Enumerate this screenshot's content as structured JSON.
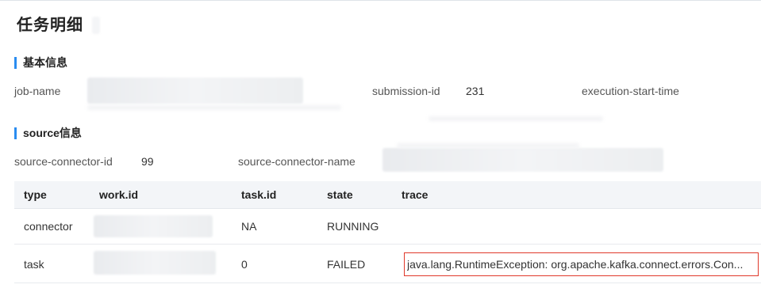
{
  "page": {
    "title": "任务明细"
  },
  "basic_info": {
    "section_title": "基本信息",
    "job_name_label": "job-name",
    "submission_id_label": "submission-id",
    "submission_id_value": "231",
    "execution_start_time_label": "execution-start-time"
  },
  "source_info": {
    "section_title": "source信息",
    "connector_id_label": "source-connector-id",
    "connector_id_value": "99",
    "connector_name_label": "source-connector-name"
  },
  "table": {
    "headers": {
      "type": "type",
      "work_id": "work.id",
      "task_id": "task.id",
      "state": "state",
      "trace": "trace"
    },
    "rows": [
      {
        "type": "connector",
        "task_id": "NA",
        "state": "RUNNING",
        "trace": ""
      },
      {
        "type": "task",
        "task_id": "0",
        "state": "FAILED",
        "trace": "java.lang.RuntimeException: org.apache.kafka.connect.errors.Con..."
      }
    ]
  },
  "colors": {
    "accent": "#2a8cf0",
    "highlight_border": "#e0392b",
    "header_bg": "#f3f5f8"
  }
}
